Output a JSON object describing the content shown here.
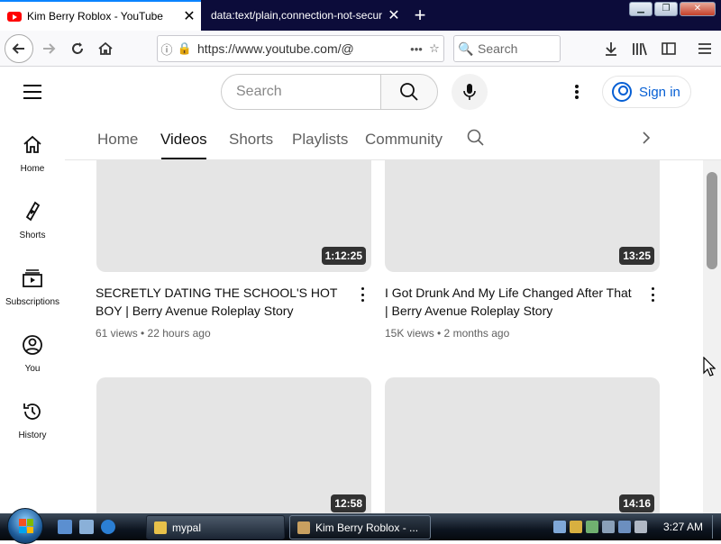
{
  "browser": {
    "tabs": [
      {
        "title": "Kim Berry Roblox - YouTube",
        "active": true
      },
      {
        "title": "data:text/plain,connection-not-secure",
        "active": false
      }
    ],
    "new_tab_glyph": "+",
    "url": "https://www.youtube.com/@",
    "search_placeholder": "Search",
    "window_buttons": [
      "minimize",
      "maximize",
      "close"
    ]
  },
  "youtube": {
    "search_placeholder": "Search",
    "sign_in_label": "Sign in",
    "sidebar": [
      {
        "label": "Home",
        "icon": "home-icon"
      },
      {
        "label": "Shorts",
        "icon": "shorts-icon"
      },
      {
        "label": "Subscriptions",
        "icon": "subscriptions-icon"
      },
      {
        "label": "You",
        "icon": "you-icon"
      },
      {
        "label": "History",
        "icon": "history-icon"
      }
    ],
    "channel_tabs": [
      {
        "label": "Home",
        "active": false
      },
      {
        "label": "Videos",
        "active": true
      },
      {
        "label": "Shorts",
        "active": false
      },
      {
        "label": "Playlists",
        "active": false
      },
      {
        "label": "Community",
        "active": false
      }
    ],
    "videos": [
      {
        "title": "SECRETLY DATING THE SCHOOL'S HOT BOY | Berry Avenue Roleplay Story",
        "duration": "1:12:25",
        "meta": "61 views • 22 hours ago"
      },
      {
        "title": "I Got Drunk And My Life Changed After That | Berry Avenue Roleplay Story",
        "duration": "13:25",
        "meta": "15K views • 2 months ago"
      },
      {
        "title": "",
        "duration": "12:58",
        "meta": ""
      },
      {
        "title": "",
        "duration": "14:16",
        "meta": ""
      }
    ]
  },
  "taskbar": {
    "buttons": [
      {
        "label": "mypal",
        "active": false
      },
      {
        "label": "Kim Berry Roblox - ...",
        "active": true
      }
    ],
    "clock": "3:27 AM"
  },
  "colors": {
    "brand_red": "#ff0000",
    "link_blue": "#065fd4",
    "tabbar_bg": "#0c0c3a"
  }
}
